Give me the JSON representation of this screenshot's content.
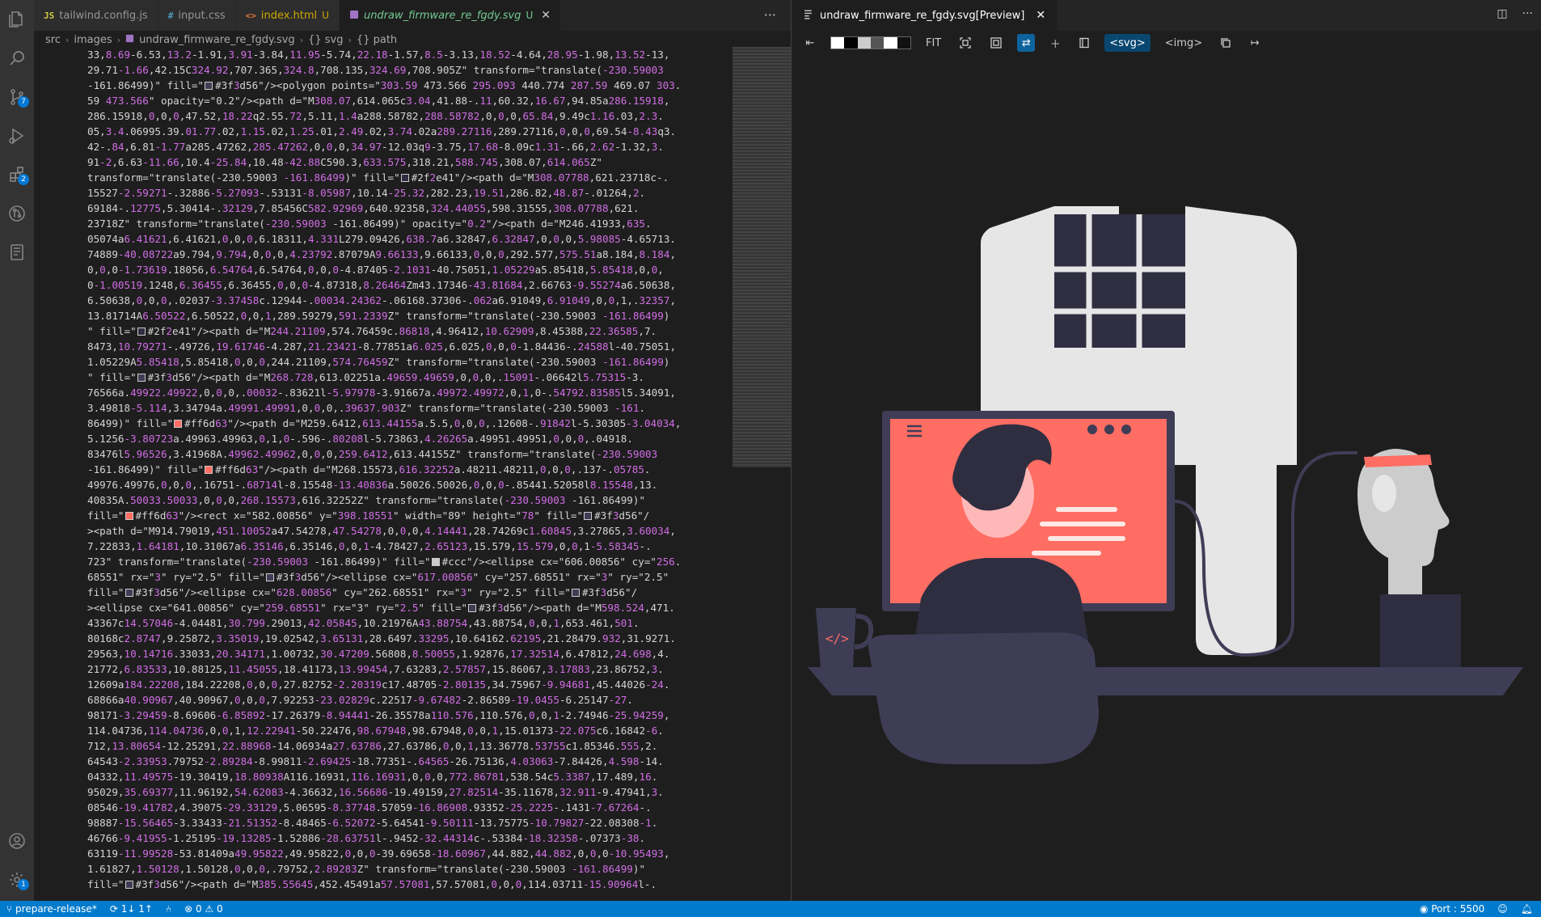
{
  "editor": {
    "tabs": [
      {
        "icon": "JS",
        "name": "tailwind.config.js",
        "status": "",
        "active": false
      },
      {
        "icon": "#",
        "name": "input.css",
        "status": "",
        "active": false
      },
      {
        "icon": "<>",
        "name": "index.html",
        "status": "U",
        "active": false
      },
      {
        "icon": "svg",
        "name": "undraw_firmware_re_fgdy.svg",
        "status": "U",
        "active": true
      }
    ],
    "more_label": "···",
    "breadcrumbs": [
      "src",
      "images",
      "undraw_firmware_re_fgdy.svg",
      "{} svg",
      "{} path"
    ],
    "code_lines": [
      "33,8.69-6.53,13.2-1.91,3.91-3.84,11.95-5.74,22.18-1.57,8.5-3.13,18.52-4.64,28.95-1.98,13.52-13,",
      "29.71-1.66,42.15C324.92,707.365,324.8,708.135,324.69,708.905Z\" transform=\"translate(-230.59003",
      "-161.86499)\" fill=\"[#3f3d56]#3f3d56\"/><polygon points=\"303.59 473.566 295.093 440.774 287.59 469.07 303.",
      "59 473.566\" opacity=\"0.2\"/><path d=\"M308.07,614.065c3.04,41.88-.11,60.32,16.67,94.85a286.15918,",
      "286.15918,0,0,0,47.52,18.22q2.55.72,5.11,1.4a288.58782,288.58782,0,0,0,65.84,9.49c1.16.03,2.3.",
      "05,3.4.06995.39.01.77.02,1.15.02,1.25.01,2.49.02,3.74.02a289.27116,289.27116,0,0,0,69.54-8.43q3.",
      "42-.84,6.81-1.77a285.47262,285.47262,0,0,0,34.97-12.03q9-3.75,17.68-8.09c1.31-.66,2.62-1.32,3.",
      "91-2,6.63-11.66,10.4-25.84,10.48-42.88C590.3,633.575,318.21,588.745,308.07,614.065Z\"",
      "transform=\"translate(-230.59003 -161.86499)\" fill=\"[#2f2e41]#2f2e41\"/><path d=\"M308.07788,621.23718c-.",
      "15527-2.59271-.32886-5.27093-.53131-8.05987,10.14-25.32,282.23,19.51,286.82,48.87-.01264,2.",
      "69184-.12775,5.30414-.32129,7.85456C582.92969,640.92358,324.44055,598.31555,308.07788,621.",
      "23718Z\" transform=\"translate(-230.59003 -161.86499)\" opacity=\"0.2\"/><path d=\"M246.41933,635.",
      "05074a6.41621,6.41621,0,0,0,6.18311,4.331L279.09426,638.7a6.32847,6.32847,0,0,0,5.98085-4.65713.",
      "74889-40.08722a9.794,9.794,0,0,0,4.23792.87079A9.66133,9.66133,0,0,0,292.577,575.51a8.184,8.184,",
      "0,0,0-1.73619.18056,6.54764,6.54764,0,0,0-4.87405-2.1031-40.75051,1.05229a5.85418,5.85418,0,0,",
      "0-1.00519.1248,6.36455,6.36455,0,0,0-4.87318,8.26464Zm43.17346-43.81684,2.66763-9.55274a6.50638,",
      "6.50638,0,0,0,.02037-3.37458c.12944-.00034.24362-.06168.37306-.062a6.91049,6.91049,0,0,1,.32357,",
      "13.81714A6.50522,6.50522,0,0,1,289.59279,591.2339Z\" transform=\"translate(-230.59003 -161.86499)",
      "\" fill=\"[#2f2e41]#2f2e41\"/><path d=\"M244.21109,574.76459c.86818,4.96412,10.62909,8.45388,22.36585,7.",
      "8473,10.79271-.49726,19.61746-4.287,21.23421-8.77851a6.025,6.025,0,0,0-1.84436-.24588l-40.75051,",
      "1.05229A5.85418,5.85418,0,0,0,244.21109,574.76459Z\" transform=\"translate(-230.59003 -161.86499)",
      "\" fill=\"[#3f3d56]#3f3d56\"/><path d=\"M268.728,613.02251a.49659.49659,0,0,0,.15091-.06642l5.75315-3.",
      "76566a.49922.49922,0,0,0,.00032-.83621l-5.97978-3.91667a.49972.49972,0,1,0-.54792.83585l5.34091,",
      "3.49818-5.114,3.34794a.49991.49991,0,0,0,.39637.903Z\" transform=\"translate(-230.59003 -161.",
      "86499)\" fill=\"[#ff6d63]#ff6d63\"/><path d=\"M259.6412,613.44155a.5.5,0,0,0,.12608-.91842l-5.30305-3.04034,",
      "5.1256-3.80723a.49963.49963,0,1,0-.596-.80208l-5.73863,4.26265a.49951.49951,0,0,0,.04918.",
      "83476l5.96526,3.41968A.49962.49962,0,0,0,259.6412,613.44155Z\" transform=\"translate(-230.59003",
      "-161.86499)\" fill=\"[#ff6d63]#ff6d63\"/><path d=\"M268.15573,616.32252a.48211.48211,0,0,0,.137-.05785.",
      "49976.49976,0,0,0,.16751-.68714l-8.15548-13.40836a.50026.50026,0,0,0-.85441.52058l8.15548,13.",
      "40835A.50033.50033,0,0,0,268.15573,616.32252Z\" transform=\"translate(-230.59003 -161.86499)\"",
      "fill=\"[#ff6d63]#ff6d63\"/><rect x=\"582.00856\" y=\"398.18551\" width=\"89\" height=\"78\" fill=\"[#3f3d56]#3f3d56\"/",
      "><path d=\"M914.79019,451.10052a47.54278,47.54278,0,0,0,4.14441,28.74269c1.60845,3.27865,3.60034,",
      "7.22833,1.64181,10.31067a6.35146,6.35146,0,0,1-4.78427,2.65123,15.579,15.579,0,0,1-5.58345-.",
      "723\" transform=\"translate(-230.59003 -161.86499)\" fill=\"[#cccccc]#ccc\"/><ellipse cx=\"606.00856\" cy=\"256.",
      "68551\" rx=\"3\" ry=\"2.5\" fill=\"[#3f3d56]#3f3d56\"/><ellipse cx=\"617.00856\" cy=\"257.68551\" rx=\"3\" ry=\"2.5\"",
      "fill=\"[#3f3d56]#3f3d56\"/><ellipse cx=\"628.00856\" cy=\"262.68551\" rx=\"3\" ry=\"2.5\" fill=\"[#3f3d56]#3f3d56\"/",
      "><ellipse cx=\"641.00856\" cy=\"259.68551\" rx=\"3\" ry=\"2.5\" fill=\"[#3f3d56]#3f3d56\"/><path d=\"M598.524,471.",
      "43367c14.57046-4.04481,30.799.29013,42.05845,10.21976A43.88754,43.88754,0,0,1,653.461,501.",
      "80168c2.8747,9.25872,3.35019,19.02542,3.65131,28.6497.33295,10.64162.62195,21.28479.932,31.9271.",
      "29563,10.14716.33033,20.34171,1.00732,30.47209.56808,8.50055,1.92876,17.32514,6.47812,24.698,4.",
      "21772,6.83533,10.88125,11.45055,18.41173,13.99454,7.63283,2.57857,15.86067,3.17883,23.86752,3.",
      "12609a184.22208,184.22208,0,0,0,27.82752-2.20319c17.48705-2.80135,34.75967-9.94681,45.44026-24.",
      "68866a40.90967,40.90967,0,0,0,7.92253-23.02829c.22517-9.67482-2.86589-19.0455-6.25147-27.",
      "98171-3.29459-8.69606-6.85892-17.26379-8.94441-26.35578a110.576,110.576,0,0,1-2.74946-25.94259,",
      "114.04736,114.04736,0,0,1,12.22941-50.22476,98.67948,98.67948,0,0,1,15.01373-22.075c6.16842-6.",
      "712,13.80654-12.25291,22.88968-14.06934a27.63786,27.63786,0,0,1,13.36778.53755c1.85346.555,2.",
      "64543-2.33953.79752-2.89284-8.99811-2.69425-18.77351-.64565-26.75136,4.03063-7.84426,4.598-14.",
      "04332,11.49575-19.30419,18.80938A116.16931,116.16931,0,0,0,772.86781,538.54c5.3387,17.489,16.",
      "95029,35.69377,11.96192,54.62083-4.36632,16.56686-19.49159,27.82514-35.11678,32.911-9.47941,3.",
      "08546-19.41782,4.39075-29.33129,5.06595-8.37748.57059-16.86908.93352-25.2225-.1431-7.67264-.",
      "98887-15.56465-3.33433-21.51352-8.48465-6.52072-5.64541-9.50111-13.75775-10.79827-22.08308-1.",
      "46766-9.41955-1.25195-19.13285-1.52886-28.63751l-.9452-32.44314c-.53384-18.32358-.07373-38.",
      "63119-11.99528-53.81409a49.95822,49.95822,0,0,0-39.69658-18.60967,44.882,44.882,0,0,0-10.95493,",
      "1.61827,1.50128,1.50128,0,0,0,.79752,2.89283Z\" transform=\"translate(-230.59003 -161.86499)\"",
      "fill=\"[#3f3d56]#3f3d56\"/><path d=\"M385.55645,452.45491a57.57081,57.57081,0,0,0,114.03711-15.90964l-."
    ]
  },
  "preview": {
    "tab_label": "undraw_firmware_re_fgdy.svg[Preview]",
    "fit_label": "FIT",
    "svg_tag_label": "<svg>",
    "img_tag_label": "<img>",
    "bg_color": "#2f2e41",
    "screen_color": "#ff6d63",
    "window_color": "#e6e6e6"
  },
  "statusbar": {
    "branch": "prepare-release*",
    "sync": "1↓ 1↑",
    "problems": "⊗ 0 ⚠ 0",
    "port": "Port : 5500"
  },
  "activitybar": {
    "scm_badge": "7",
    "extensions_badge": "2",
    "settings_badge": "1"
  }
}
